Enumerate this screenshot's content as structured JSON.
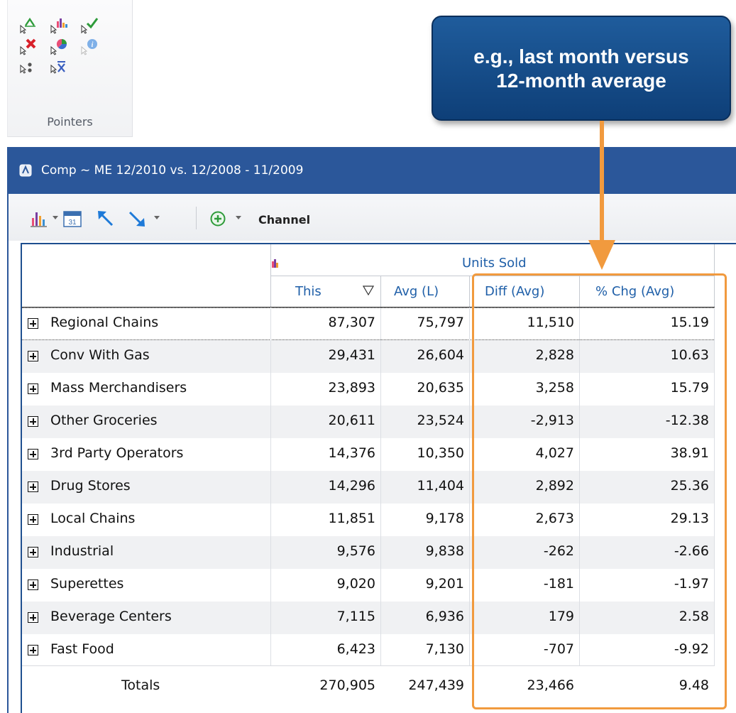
{
  "ribbon": {
    "group_label": "Pointers",
    "icons": [
      "pointer-trend-icon",
      "pointer-chart-icon",
      "pointer-check-icon",
      "pointer-delete-icon",
      "pointer-pie-icon",
      "pointer-info-icon",
      "pointer-dots-icon",
      "pointer-clear-icon"
    ]
  },
  "callout": {
    "line1": "e.g., last month versus",
    "line2": "12-month average"
  },
  "window": {
    "title": "Comp ~ ME 12/2010  vs. 12/2008 - 11/2009"
  },
  "toolbar": {
    "channel_label": "Channel"
  },
  "grid": {
    "group_header": "Units Sold",
    "columns": [
      "This",
      "Avg (L)",
      "Diff (Avg)",
      "% Chg (Avg)"
    ],
    "rows": [
      {
        "name": "Regional Chains",
        "this": "87,307",
        "avg": "75,797",
        "diff": "11,510",
        "pct": "15.19"
      },
      {
        "name": "Conv With Gas",
        "this": "29,431",
        "avg": "26,604",
        "diff": "2,828",
        "pct": "10.63"
      },
      {
        "name": "Mass Merchandisers",
        "this": "23,893",
        "avg": "20,635",
        "diff": "3,258",
        "pct": "15.79"
      },
      {
        "name": "Other Groceries",
        "this": "20,611",
        "avg": "23,524",
        "diff": "-2,913",
        "pct": "-12.38"
      },
      {
        "name": "3rd Party Operators",
        "this": "14,376",
        "avg": "10,350",
        "diff": "4,027",
        "pct": "38.91"
      },
      {
        "name": "Drug Stores",
        "this": "14,296",
        "avg": "11,404",
        "diff": "2,892",
        "pct": "25.36"
      },
      {
        "name": "Local Chains",
        "this": "11,851",
        "avg": "9,178",
        "diff": "2,673",
        "pct": "29.13"
      },
      {
        "name": "Industrial",
        "this": "9,576",
        "avg": "9,838",
        "diff": "-262",
        "pct": "-2.66"
      },
      {
        "name": "Superettes",
        "this": "9,020",
        "avg": "9,201",
        "diff": "-181",
        "pct": "-1.97"
      },
      {
        "name": "Beverage Centers",
        "this": "7,115",
        "avg": "6,936",
        "diff": "179",
        "pct": "2.58"
      },
      {
        "name": "Fast Food",
        "this": "6,423",
        "avg": "7,130",
        "diff": "-707",
        "pct": "-9.92"
      }
    ],
    "totals": {
      "label": "Totals",
      "this": "270,905",
      "avg": "247,439",
      "diff": "23,466",
      "pct": "9.48"
    }
  },
  "colors": {
    "title_bar": "#2b579a",
    "callout": "#0e3f78",
    "highlight": "#f19a3e",
    "header_text": "#1f5fa8"
  }
}
